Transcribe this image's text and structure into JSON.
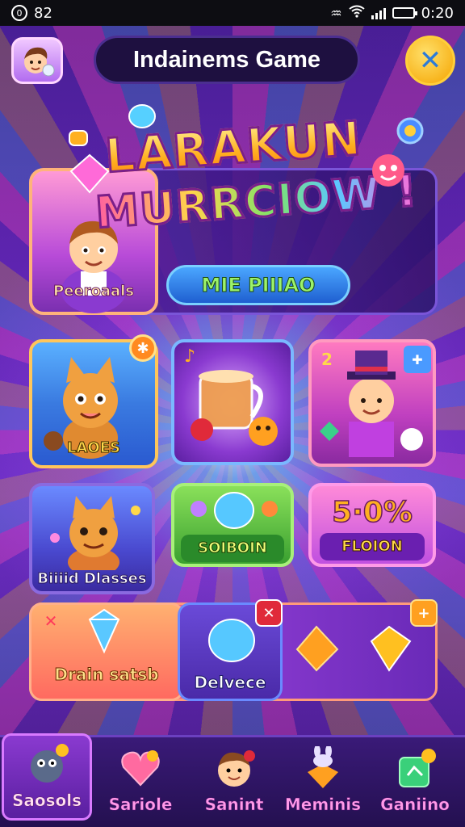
{
  "status_bar": {
    "left_icon": "circle-zero-icon",
    "left_text": "82",
    "right_text": "0:20",
    "icons": [
      "vibrate-icon",
      "wifi-icon",
      "signal-icon",
      "battery-icon"
    ]
  },
  "header": {
    "avatar_icon": "player-avatar-icon",
    "title": "Indainems Game",
    "close_icon": "close-x-icon"
  },
  "logo": {
    "line1": "LARAKUN",
    "line2": "MURRCIOW !"
  },
  "hero": {
    "card_label": "Peeroaals",
    "play_button": "MIE PIIIAO"
  },
  "tiles": [
    {
      "label": "LAOES",
      "badge_icon": "orange-slice-icon"
    },
    {
      "label": "",
      "badge_icon": "music-note-icon"
    },
    {
      "label": "",
      "badge_icon": "number-badge-icon",
      "badge_text": "2"
    },
    {
      "label": "Biiiid Dlasses"
    },
    {
      "label": "SOIBOIN"
    },
    {
      "label": "FLOION",
      "headline": "5·0%"
    }
  ],
  "bottom_row": [
    {
      "label": "Drain satsb",
      "badge_icon": "close-x-icon"
    },
    {
      "label": "Delvece",
      "badge_icon": "close-x-icon"
    },
    {
      "label": "",
      "badge_icon": "plus-icon"
    }
  ],
  "nav": [
    {
      "label": "Saosols",
      "icon": "bird-character-icon",
      "active": true
    },
    {
      "label": "Sariole",
      "icon": "heart-icon",
      "active": false
    },
    {
      "label": "Sanint",
      "icon": "boy-face-icon",
      "active": false
    },
    {
      "label": "Meminis",
      "icon": "bunny-carrot-icon",
      "active": false
    },
    {
      "label": "Ganiino",
      "icon": "green-gem-icon",
      "active": false
    }
  ],
  "colors": {
    "accent_yellow": "#f5a400",
    "accent_pink": "#ff9ae8",
    "accent_green": "#9cf26a",
    "panel_purple": "#5a1fa8"
  }
}
